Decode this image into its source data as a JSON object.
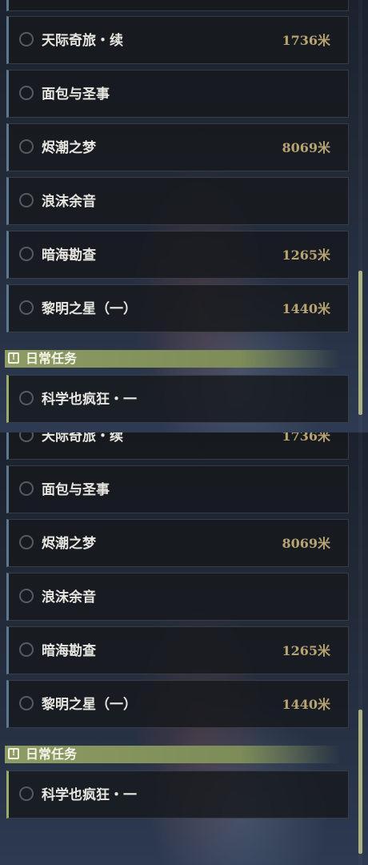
{
  "quests": [
    {
      "name": "天际奇旅・续",
      "distance": "1736米"
    },
    {
      "name": "面包与圣事",
      "distance": ""
    },
    {
      "name": "烬潮之梦",
      "distance": "8069米"
    },
    {
      "name": "浪沫余音",
      "distance": ""
    },
    {
      "name": "暗海勘查",
      "distance": "1265米"
    },
    {
      "name": "黎明之星（一）",
      "distance": "1440米"
    }
  ],
  "daily_section": {
    "title": "日常任务",
    "icon": "exclamation-icon",
    "quests": [
      {
        "name": "科学也疯狂・一",
        "distance": ""
      }
    ]
  },
  "colors": {
    "section_header": "#8d9c62",
    "distance_text": "#b8a472",
    "scrollbar": "#a9b27c"
  }
}
